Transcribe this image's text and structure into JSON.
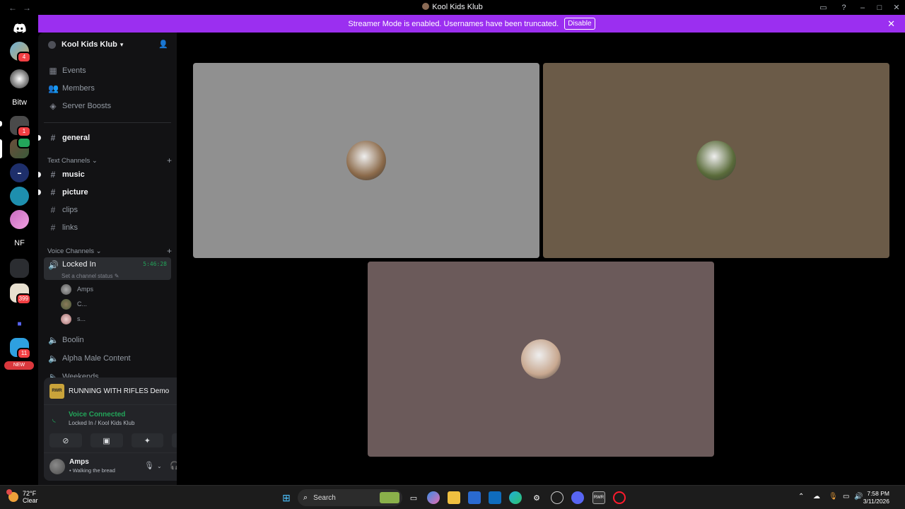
{
  "window": {
    "title": "Kool Kids Klub",
    "nav_back": "←",
    "nav_forward": "→",
    "inbox_icon": "inbox-icon",
    "help_icon": "help-icon",
    "minimize": "–",
    "maximize": "□",
    "close": "✕"
  },
  "banner": {
    "text": "Streamer Mode is enabled. Usernames have been truncated.",
    "button": "Disable",
    "close": "✕",
    "color": "#9b2ff0"
  },
  "rail": {
    "items": [
      {
        "label": "",
        "icon": "discord-home-icon",
        "color": "#5865f2"
      },
      {
        "label": "",
        "badge": "4",
        "color": "#6bb0d6"
      },
      {
        "label": "",
        "color": "#d8d8d8"
      },
      {
        "label": "Bitw",
        "color": "#000000"
      },
      {
        "label": "",
        "badge": "1",
        "color": "#4a4a4a"
      },
      {
        "label": "",
        "badge": "",
        "color": "#6b4d3a"
      },
      {
        "label": "",
        "color": "#1e2f6b"
      },
      {
        "label": "",
        "color": "#1e8fae"
      },
      {
        "label": "",
        "color": "#c86bc0"
      },
      {
        "label": "NF",
        "color": "#000000"
      },
      {
        "label": "",
        "color": "#3d4a3a"
      },
      {
        "label": "",
        "badge": "399",
        "color": "#e8e0d0"
      },
      {
        "label": "",
        "color": "#5865f2"
      },
      {
        "label": "",
        "badge": "11",
        "color": "#2ea0e0"
      },
      {
        "label": "NEW",
        "color": "#da373c"
      }
    ]
  },
  "sidebar": {
    "server_name": "Kool Kids Klub",
    "top_items": [
      {
        "label": "Events",
        "icon": "calendar-icon"
      },
      {
        "label": "Members",
        "icon": "members-icon"
      },
      {
        "label": "Server Boosts",
        "icon": "boost-icon"
      }
    ],
    "general": "general",
    "text_category": "Text Channels",
    "text_channels": [
      "music",
      "picture",
      "clips",
      "links"
    ],
    "voice_category": "Voice Channels",
    "voice_channel": {
      "name": "Locked In",
      "timer": "5:46:28",
      "status_hint": "Set a channel status",
      "users": [
        "Amps",
        "C...",
        "s..."
      ]
    },
    "other_voice": [
      "Boolin",
      "Alpha Male Content",
      "Weekends"
    ]
  },
  "activity": {
    "game": "RUNNING WITH RIFLES Demo",
    "game_icon_text": "RWR"
  },
  "voice": {
    "title": "Voice Connected",
    "subtitle": "Locked In / Kool Kids Klub"
  },
  "user": {
    "name": "Amps",
    "status": "• Walking the bread"
  },
  "video": {
    "tiles": [
      {
        "bg": "#909090",
        "avatar": "#8b6a4a"
      },
      {
        "bg": "#6b5b48",
        "avatar": "#5a6b3a"
      },
      {
        "bg": "#6b5a5a",
        "avatar": "#c8a890"
      }
    ]
  },
  "taskbar": {
    "temp": "72°F",
    "condition": "Clear",
    "search": "Search",
    "time": "7:58 PM",
    "date": "3/11/2026"
  }
}
